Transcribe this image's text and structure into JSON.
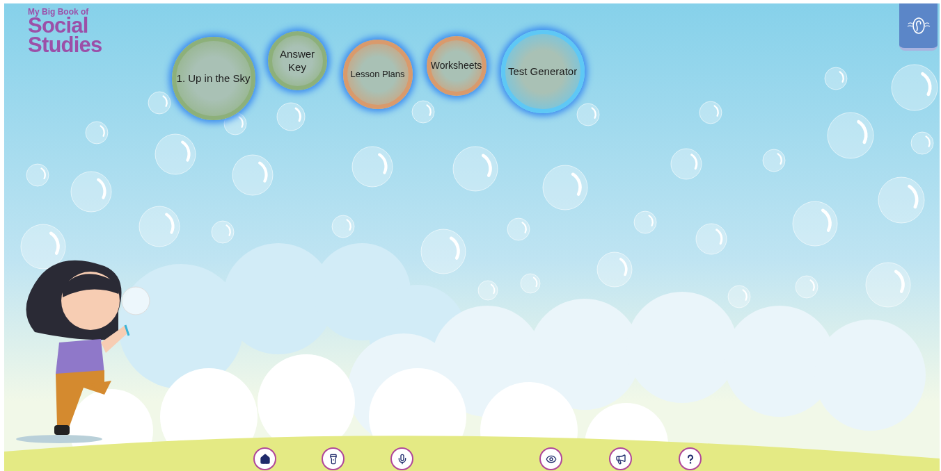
{
  "logo": {
    "subtitle": "My Big Book of",
    "title_lines": [
      "Social",
      "Studies"
    ]
  },
  "menu": [
    {
      "label": "1. Up in the Sky",
      "color": "#8db07a"
    },
    {
      "label": "Answer Key",
      "color": "#8db07a"
    },
    {
      "label": "Lesson Plans",
      "color": "#d99a6c"
    },
    {
      "label": "Worksheets",
      "color": "#d99a6c"
    },
    {
      "label": "Test Generator",
      "color": "#5ec8f5"
    }
  ]
}
